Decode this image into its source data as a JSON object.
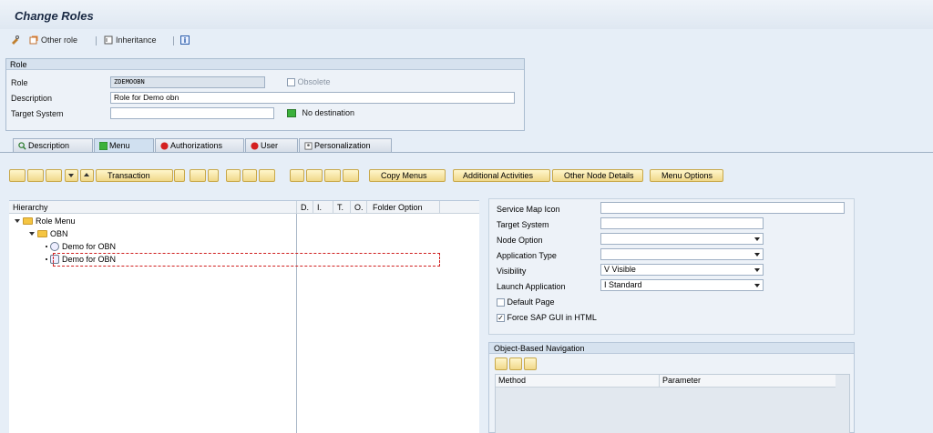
{
  "title": "Change Roles",
  "toolbar": {
    "other_role": "Other role",
    "inheritance": "Inheritance"
  },
  "role": {
    "section_title": "Role",
    "role_label": "Role",
    "role_value": "ZDEMOOBN",
    "obsolete_label": "Obsolete",
    "description_label": "Description",
    "description_value": "Role for Demo obn",
    "target_label": "Target System",
    "target_value": "",
    "destination_status": "No destination"
  },
  "tabs": [
    "Description",
    "Menu",
    "Authorizations",
    "User",
    "Personalization"
  ],
  "buttons": {
    "transaction": "Transaction",
    "copy_menus": "Copy Menus",
    "additional_activities": "Additional Activities",
    "other_node_details": "Other Node Details",
    "menu_options": "Menu Options"
  },
  "tree": {
    "columns": [
      "Hierarchy",
      "D.",
      "I.",
      "T.",
      "O.",
      "Folder Option"
    ],
    "nodes": [
      "Role Menu",
      "OBN",
      "Demo for OBN",
      "Demo for OBN"
    ]
  },
  "details": {
    "service_map_icon": "Service Map Icon",
    "target_system": "Target System",
    "node_option": "Node Option",
    "application_type": "Application Type",
    "visibility_label": "Visibility",
    "visibility_value": "V Visible",
    "launch_label": "Launch Application",
    "launch_value": "I Standard",
    "default_page": "Default Page",
    "force_gui": "Force SAP GUI in HTML"
  },
  "obn": {
    "title": "Object-Based Navigation",
    "columns": [
      "Method",
      "Parameter"
    ]
  },
  "colors": {
    "title_text": "#1a2a44",
    "panel": "#edf2f8",
    "button": "#f0d88a",
    "status_green": "#3bb13b",
    "status_red": "#d42020"
  }
}
